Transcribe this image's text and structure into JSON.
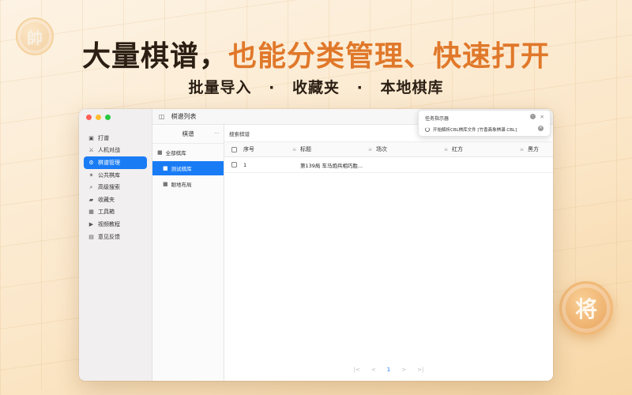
{
  "headline": {
    "part1": "大量棋谱，",
    "part2": "也能分类管理、快速打开"
  },
  "subline": {
    "items": [
      "批量导入",
      "收藏夹",
      "本地棋库"
    ],
    "separator": "·"
  },
  "pieces": {
    "left": "帥",
    "right": "将"
  },
  "window": {
    "title": "棋谱列表",
    "sidebar": {
      "items": [
        {
          "label": "打谱",
          "icon": "board-icon"
        },
        {
          "label": "人机对战",
          "icon": "battle-icon"
        },
        {
          "label": "棋谱管理",
          "icon": "gear-icon",
          "active": true
        },
        {
          "label": "公共棋库",
          "icon": "star-icon"
        },
        {
          "label": "高级搜索",
          "icon": "search-icon"
        },
        {
          "label": "收藏夹",
          "icon": "folder-icon"
        },
        {
          "label": "工具箱",
          "icon": "toolbox-icon"
        },
        {
          "label": "视频教程",
          "icon": "play-icon"
        },
        {
          "label": "意见反馈",
          "icon": "feedback-icon"
        }
      ]
    },
    "library": {
      "header": "棋谱",
      "more": "···",
      "items": [
        {
          "label": "全部棋库"
        },
        {
          "label": "测试棋库",
          "active": true
        },
        {
          "label": "眼地布局"
        }
      ]
    },
    "main": {
      "search_label": "搜索棋谱",
      "columns": [
        "序号",
        "标题",
        "场次",
        "红方",
        "黑方"
      ],
      "rows": [
        {
          "index": "1",
          "title": "第139局  车马炮兵相巧胜...",
          "round": "",
          "red": "",
          "black": ""
        }
      ],
      "pager": {
        "first": "|<",
        "prev": "<",
        "page": "1",
        "next": ">",
        "last": ">|"
      }
    },
    "task": {
      "title": "任务指示器",
      "message": "开始解析CBL棋库文件 [竹香斋象棋谱.CBL]"
    }
  }
}
